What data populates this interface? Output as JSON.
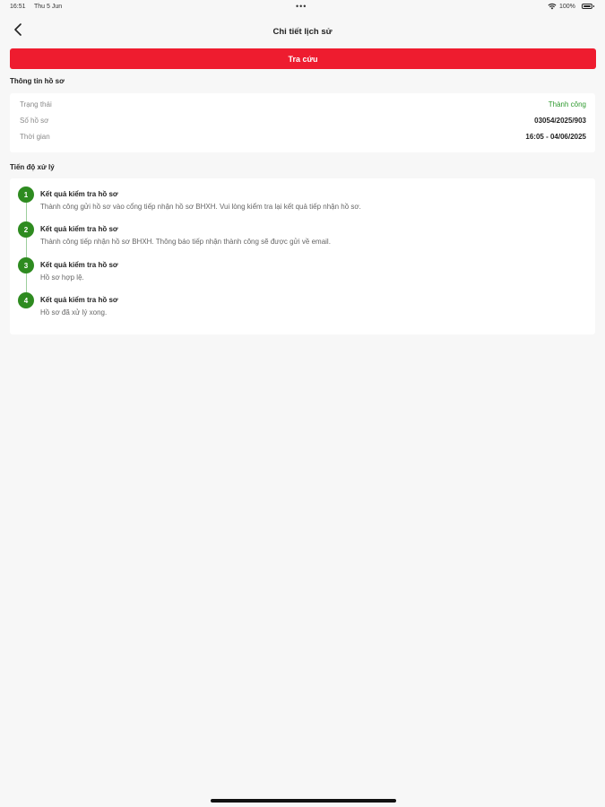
{
  "status_bar": {
    "time": "16:51",
    "date": "Thu 5 Jun",
    "dots": "•••",
    "battery_pct": "100%"
  },
  "nav": {
    "title": "Chi tiết lịch sử",
    "back_icon": "chevron-left-icon"
  },
  "actions": {
    "search_label": "Tra cứu",
    "search_color": "#ee1c2f"
  },
  "profile_info": {
    "section_title": "Thông tin hồ sơ",
    "rows": [
      {
        "label": "Trạng thái",
        "value": "Thành công"
      },
      {
        "label": "Số hồ sơ",
        "value": "03054/2025/903"
      },
      {
        "label": "Thời gian",
        "value": "16:05 - 04/06/2025"
      }
    ],
    "success_color": "#2e9a2e"
  },
  "progress": {
    "section_title": "Tiến độ xử lý",
    "step_color": "#2e8b20",
    "steps": [
      {
        "number": "1",
        "title": "Kết quả kiểm tra hồ sơ",
        "description": "Thành công gửi hồ sơ vào cổng tiếp nhận hồ sơ BHXH. Vui lòng kiểm tra lại kết quả tiếp nhận hồ sơ."
      },
      {
        "number": "2",
        "title": "Kết quả kiểm tra hồ sơ",
        "description": "Thành công tiếp nhận hồ sơ BHXH. Thông báo tiếp nhận thành công sẽ được gửi về email."
      },
      {
        "number": "3",
        "title": "Kết quả kiểm tra hồ sơ",
        "description": "Hồ sơ hợp lệ."
      },
      {
        "number": "4",
        "title": "Kết quả kiểm tra hồ sơ",
        "description": "Hồ sơ đã xử lý xong."
      }
    ]
  }
}
